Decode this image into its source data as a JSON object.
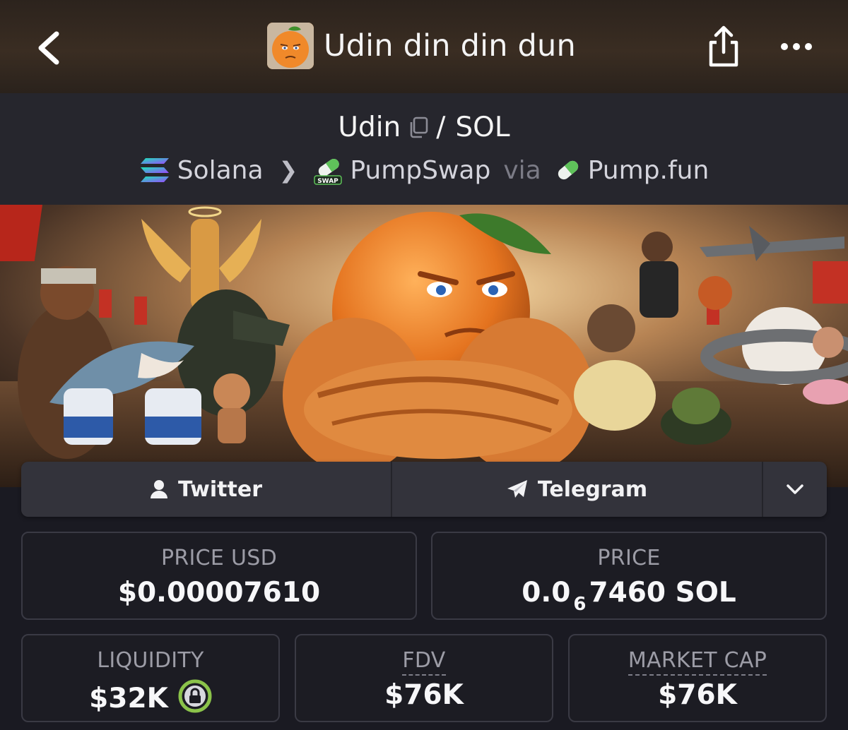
{
  "header": {
    "title": "Udin din din dun",
    "back_icon": "chevron-left-icon",
    "share_icon": "share-icon",
    "more_icon": "more-horizontal-icon"
  },
  "pair": {
    "base": "Udin",
    "separator": "/",
    "quote": "SOL",
    "chain": "Solana",
    "dex": "PumpSwap",
    "dex_badge": "SWAP",
    "via": "via",
    "launchpad": "Pump.fun"
  },
  "links": {
    "twitter": "Twitter",
    "telegram": "Telegram"
  },
  "stats": {
    "price_usd": {
      "label": "PRICE USD",
      "value": "$0.00007610"
    },
    "price": {
      "label": "PRICE",
      "prefix": "0.0",
      "zeros": "6",
      "suffix": "7460 SOL"
    },
    "liquidity": {
      "label": "LIQUIDITY",
      "value": "$32K"
    },
    "fdv": {
      "label": "FDV",
      "value": "$76K"
    },
    "market_cap": {
      "label": "MARKET CAP",
      "value": "$76K"
    }
  },
  "colors": {
    "accent_green": "#8bc34a",
    "background": "#1a1a22",
    "card": "#33333b"
  }
}
